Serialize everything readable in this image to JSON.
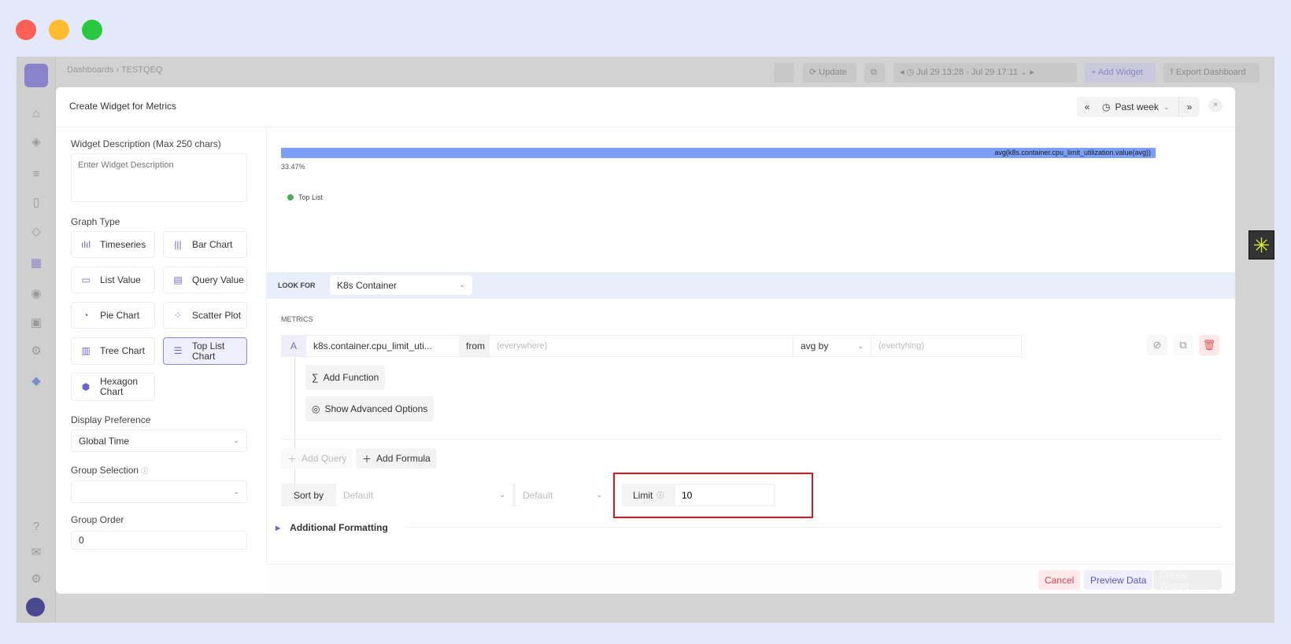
{
  "window": {
    "controls": [
      "close",
      "minimize",
      "maximize"
    ],
    "colors": {
      "close": "#fe5f57",
      "minimize": "#febc2e",
      "maximize": "#28c840"
    }
  },
  "topbar": {
    "breadcrumb": [
      "Dashboards",
      "TESTQEQ"
    ],
    "update": "Update",
    "date_range": "Jul 29 13:28 - Jul 29 17:11",
    "add_widget": "+ Add Widget",
    "export": "Export Dashboard"
  },
  "modal": {
    "title": "Create Widget for Metrics",
    "time": {
      "label": "Past week"
    },
    "left": {
      "desc_label": "Widget Description (Max 250 chars)",
      "desc_placeholder": "Enter Widget Description",
      "graph_type_label": "Graph Type",
      "graph_types": [
        {
          "label": "Timeseries",
          "icon": "timeseries-icon"
        },
        {
          "label": "Bar Chart",
          "icon": "bar-chart-icon"
        },
        {
          "label": "List Value",
          "icon": "list-value-icon"
        },
        {
          "label": "Query Value",
          "icon": "query-value-icon"
        },
        {
          "label": "Pie Chart",
          "icon": "pie-chart-icon"
        },
        {
          "label": "Scatter Plot",
          "icon": "scatter-plot-icon"
        },
        {
          "label": "Tree Chart",
          "icon": "tree-chart-icon"
        },
        {
          "label": "Top List Chart",
          "icon": "top-list-icon",
          "selected": true
        },
        {
          "label": "Hexagon Chart",
          "icon": "hexagon-chart-icon"
        }
      ],
      "display_pref_label": "Display Preference",
      "display_pref_value": "Global Time",
      "group_sel_label": "Group Selection",
      "group_sel_value": "",
      "group_order_label": "Group Order",
      "group_order_value": "0"
    },
    "preview": {
      "bar_label": "avg(k8s.container.cpu_limit_utilization.value(avg))",
      "value": "33.47%",
      "legend": "Top List",
      "bar_color": "#7b9ef6",
      "legend_color": "#4caf50"
    },
    "look_for": {
      "label": "LOOK FOR",
      "value": "K8s Container"
    },
    "metrics": {
      "label": "METRICS",
      "query": {
        "letter": "A",
        "metric": "k8s.container.cpu_limit_uti...",
        "from": "from",
        "where_placeholder": "(everywhere)",
        "agg": "avg by",
        "group_placeholder": "(evertyhing)"
      },
      "add_function": "Add Function",
      "advanced": "Show Advanced Options"
    },
    "add_query": "Add Query",
    "add_formula": "Add Formula",
    "sort": {
      "label": "Sort by",
      "field": "Default",
      "order": "Default"
    },
    "limit": {
      "label": "Limit",
      "value": "10"
    },
    "additional": "Additional Formatting",
    "footer": {
      "cancel": "Cancel",
      "preview": "Preview Data",
      "create": "Create Widget"
    }
  }
}
